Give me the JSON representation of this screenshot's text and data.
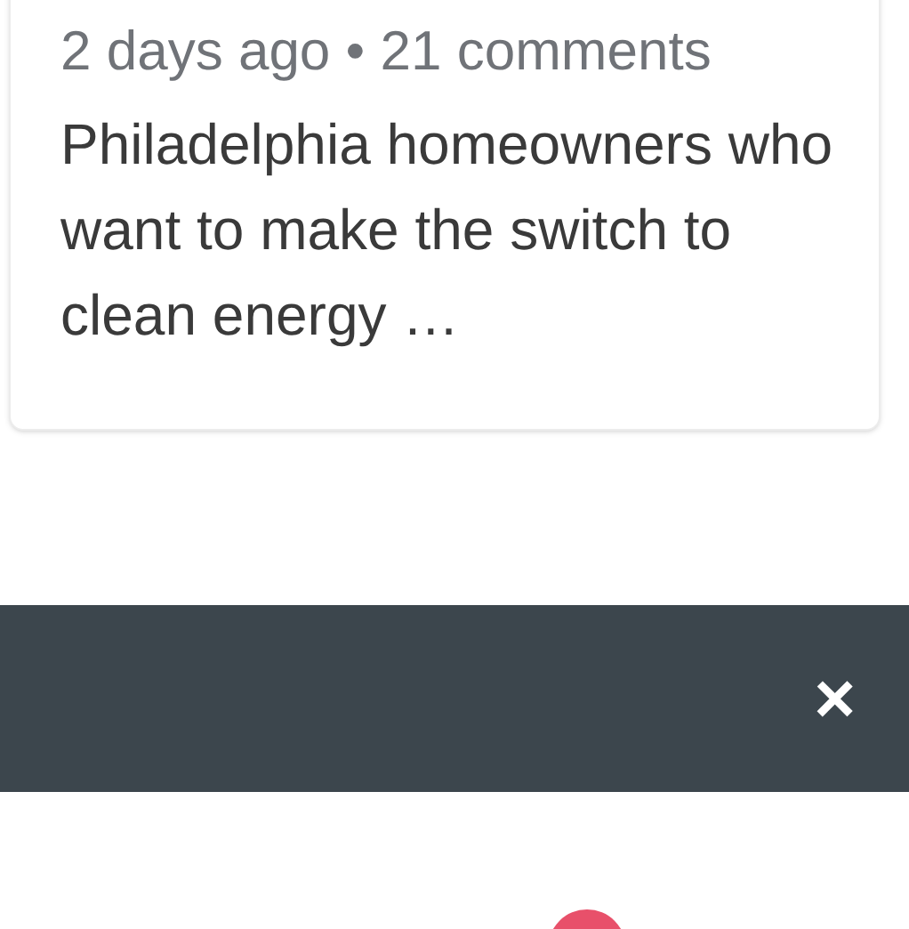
{
  "card": {
    "meta": "2 days ago • 21 comments",
    "excerpt": "Philadelphia homeowners who want to make the switch to clean energy …"
  },
  "banner": {
    "close": "×"
  }
}
